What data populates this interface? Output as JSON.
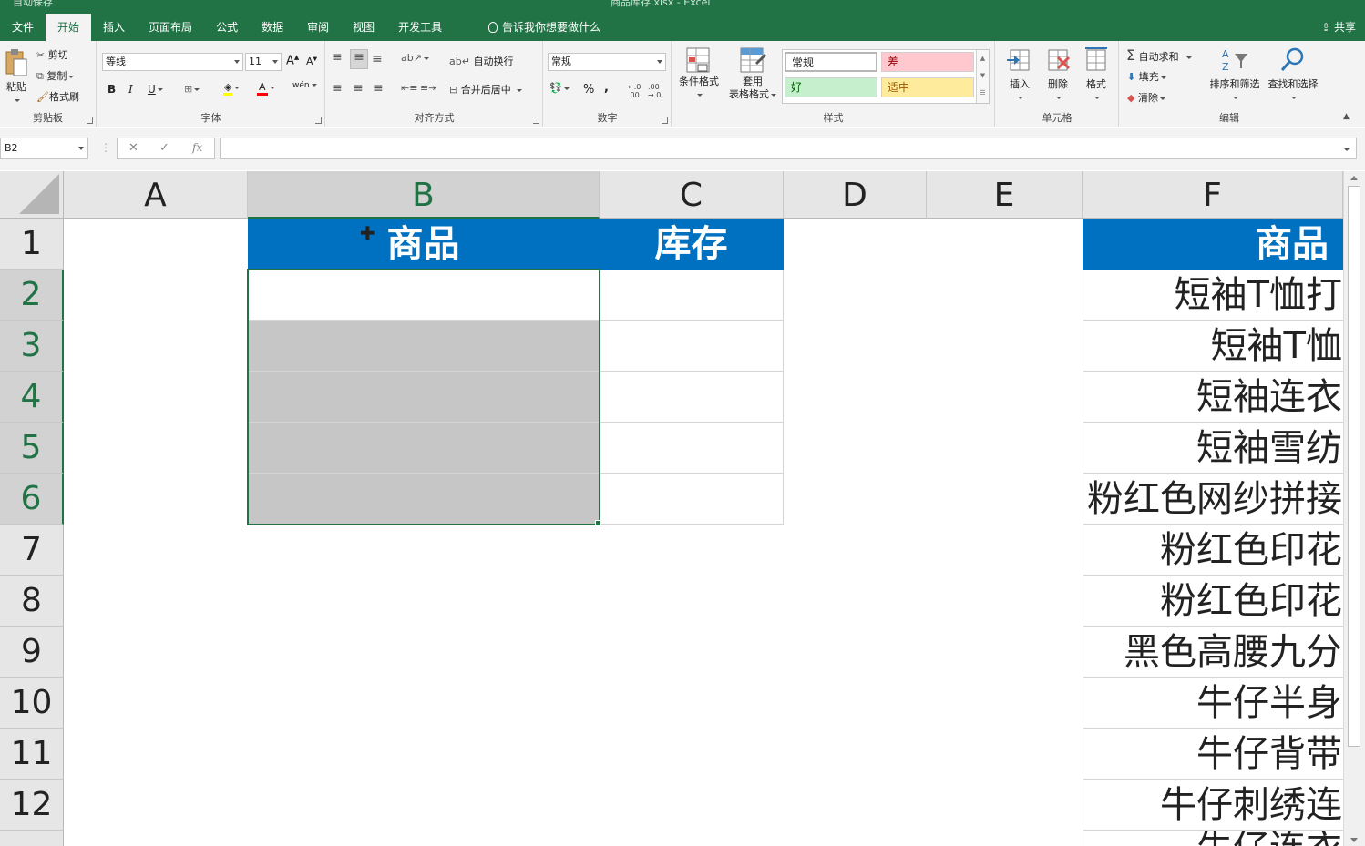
{
  "window": {
    "title": "商品库存.xlsx  -  Excel",
    "autosave": "自动保存",
    "share": "共享"
  },
  "tabs": [
    "文件",
    "开始",
    "插入",
    "页面布局",
    "公式",
    "数据",
    "审阅",
    "视图",
    "开发工具"
  ],
  "active_tab": "开始",
  "tell_me": "告诉我你想要做什么",
  "ribbon": {
    "clipboard": {
      "label": "剪贴板",
      "paste": "粘贴",
      "cut": "剪切",
      "copy": "复制",
      "painter": "格式刷"
    },
    "font": {
      "label": "字体",
      "name": "等线",
      "size": "11"
    },
    "alignment": {
      "label": "对齐方式",
      "wrap": "自动换行",
      "merge": "合并后居中"
    },
    "number": {
      "label": "数字",
      "format": "常规"
    },
    "styles": {
      "label": "样式",
      "conditional": "条件格式",
      "table_format_1": "套用",
      "table_format_2": "表格格式",
      "normal": "常规",
      "bad": "差",
      "good": "好",
      "neutral": "适中",
      "colors": {
        "bad": "#ffc7ce",
        "bad_text": "#9c0006",
        "good": "#c6efce",
        "good_text": "#006100",
        "neutral": "#ffeb9c",
        "neutral_text": "#9c5700"
      }
    },
    "cells": {
      "label": "单元格",
      "insert": "插入",
      "delete": "删除",
      "format": "格式"
    },
    "editing": {
      "label": "编辑",
      "autosum": "自动求和",
      "fill": "填充",
      "clear": "清除",
      "sort": "排序和筛选",
      "find": "查找和选择"
    }
  },
  "formula_bar": {
    "name_box": "B2",
    "cancel": "✕",
    "enter": "✓",
    "fx": "fx",
    "value": ""
  },
  "columns": [
    "A",
    "B",
    "C",
    "D",
    "E",
    "F"
  ],
  "rows": [
    "1",
    "2",
    "3",
    "4",
    "5",
    "6",
    "7",
    "8",
    "9",
    "10",
    "11",
    "12"
  ],
  "cells": {
    "B1": "商品",
    "C1": "库存",
    "F1": "商品",
    "F": [
      "短袖T恤打",
      "短袖T恤",
      "短袖连衣",
      "短袖雪纺",
      "粉红色网纱拼接",
      "粉红色印花",
      "粉红色印花",
      "黑色高腰九分",
      "牛仔半身",
      "牛仔背带",
      "牛仔刺绣连",
      "牛仔连衣"
    ]
  },
  "colors": {
    "excel_green": "#217346",
    "header_blue": "#0070c0",
    "selection_grey": "#c6c6c6"
  }
}
